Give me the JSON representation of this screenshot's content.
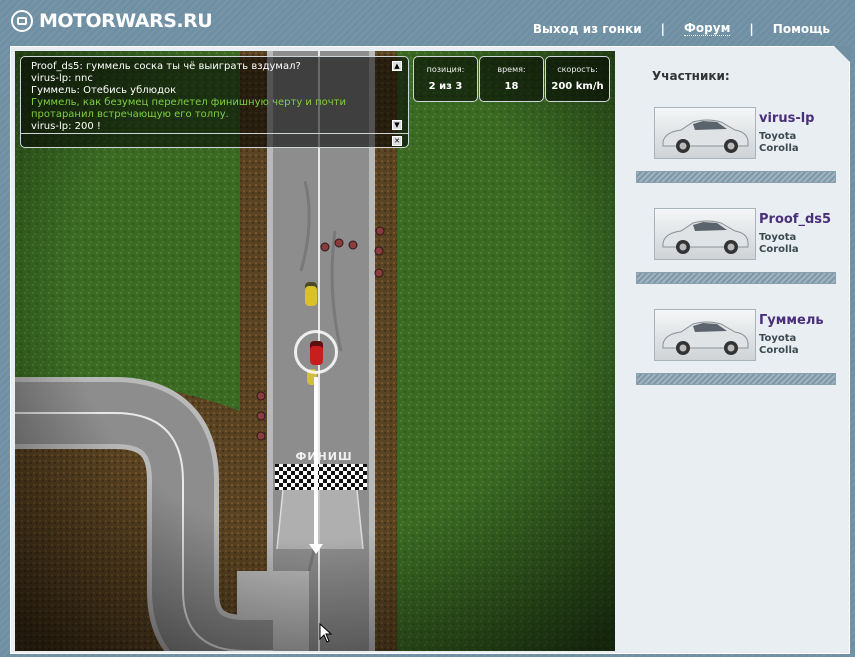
{
  "header": {
    "logo_text": "MOTORWARS.RU",
    "nav": [
      {
        "label": "Выход из гонки"
      },
      {
        "label": "Форум"
      },
      {
        "label": "Помощь"
      }
    ]
  },
  "chat": {
    "lines": [
      {
        "text": "Proof_ds5: гуммель соска ты чё выиграть вздумал?",
        "color": "white"
      },
      {
        "text": "virus-lp: nnc",
        "color": "white"
      },
      {
        "text": "Гуммель: Отебись ублюдок",
        "color": "white"
      },
      {
        "text": "Гуммель, как безумец перелетел финишную черту и почти",
        "color": "green"
      },
      {
        "text": "протаранил встречающую его толпу.",
        "color": "green"
      },
      {
        "text": "virus-lp: 200 !",
        "color": "white"
      }
    ],
    "input_value": "",
    "up_icon": "triangle-up-icon",
    "down_icon": "triangle-down-icon",
    "close_icon": "close-icon"
  },
  "stats": {
    "position_label": "позиция:",
    "position_value": "2 из 3",
    "time_label": "время:",
    "time_value": "18",
    "speed_label": "скорость:",
    "speed_value": "200 km/h"
  },
  "track": {
    "finish_label": "ФИНИШ"
  },
  "sidebar": {
    "title": "Участники:",
    "participants": [
      {
        "name": "virus-lp",
        "car_brand": "Toyota",
        "car_model": "Corolla"
      },
      {
        "name": "Proof_ds5",
        "car_brand": "Toyota",
        "car_model": "Corolla"
      },
      {
        "name": "Гуммель",
        "car_brand": "Toyota",
        "car_model": "Corolla"
      }
    ]
  },
  "colors": {
    "brand_bg": "#6f8fa3",
    "participant_name": "#4a2f7a",
    "chat_green": "#7fd040",
    "player_car": "#c81e1e",
    "opponent_car": "#d8c12a"
  }
}
